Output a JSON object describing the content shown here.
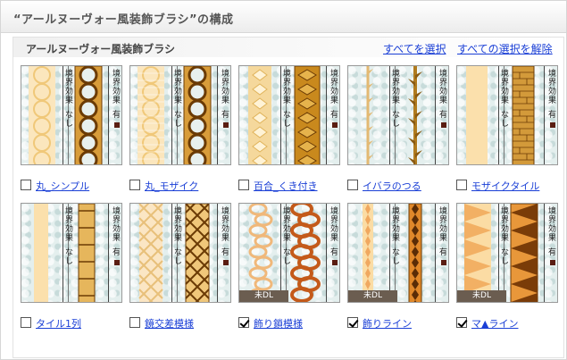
{
  "header": {
    "title": "“アールヌーヴォー風装飾ブラシ”の構成"
  },
  "panel": {
    "subtitle": "アールヌーヴォー風装飾ブラシ",
    "select_all": "すべてを選択",
    "deselect_all": "すべての選択を解除"
  },
  "common": {
    "vertical_label": [
      "境",
      "界",
      "効",
      "果"
    ],
    "none_label": [
      "な",
      "し"
    ],
    "has_label": "有",
    "badge": "未DL"
  },
  "brushes": [
    {
      "label": "丸_シンプル",
      "checked": false,
      "badge": false,
      "pattern": "circles"
    },
    {
      "label": "丸_モザイク",
      "checked": false,
      "badge": false,
      "pattern": "circles-mosaic"
    },
    {
      "label": "百合_くき付き",
      "checked": false,
      "badge": false,
      "pattern": "lily"
    },
    {
      "label": "イバラのつる",
      "checked": false,
      "badge": false,
      "pattern": "thorn"
    },
    {
      "label": "モザイクタイル",
      "checked": false,
      "badge": false,
      "pattern": "mosaic"
    },
    {
      "label": "タイル1列",
      "checked": false,
      "badge": false,
      "pattern": "tile1"
    },
    {
      "label": "鏡交差模様",
      "checked": false,
      "badge": false,
      "pattern": "cross"
    },
    {
      "label": "飾り鎖模様",
      "checked": true,
      "badge": true,
      "pattern": "chain"
    },
    {
      "label": "飾りライン",
      "checked": true,
      "badge": true,
      "pattern": "line"
    },
    {
      "label": "マ▲ライン",
      "checked": true,
      "badge": true,
      "pattern": "triangle"
    }
  ]
}
